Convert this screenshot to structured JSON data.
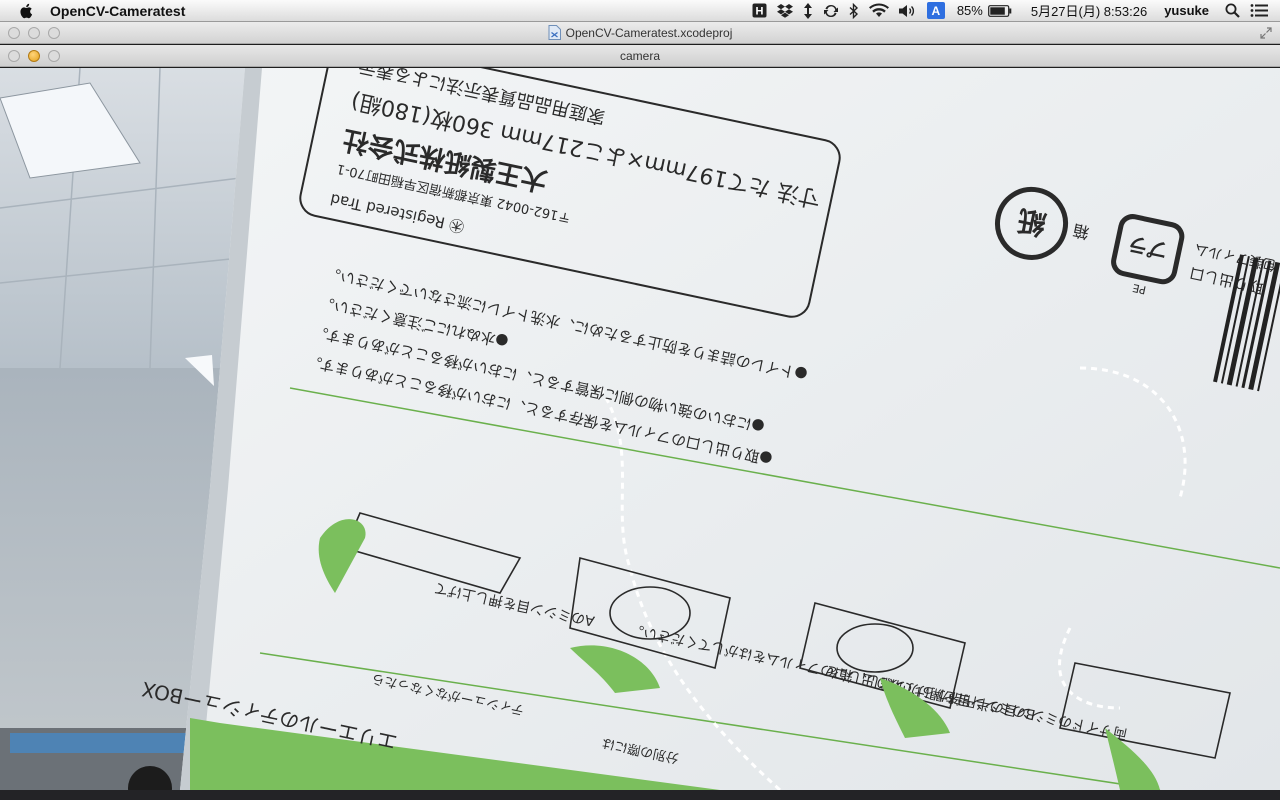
{
  "menubar": {
    "app_name": "OpenCV-Cameratest",
    "battery": "85%",
    "input_source": "A",
    "datetime": "5月27日(月)  8:53:26",
    "user": "yusuke",
    "icons": [
      "apple-icon",
      "h-icon",
      "dropbox-icon",
      "updown-icon",
      "sync-icon",
      "bluetooth-icon",
      "wifi-icon",
      "volume-icon",
      "input-source-icon",
      "battery-icon",
      "spotlight-icon",
      "list-icon"
    ]
  },
  "windows": {
    "project_title": "OpenCV-Cameratest.xcodeproj",
    "camera_title": "camera"
  },
  "camera_scene": {
    "box_top": [
      "㊍ Registered Trad",
      "〒162-0042 東京都新宿区早稲田町70-1",
      "大王製紙株式会社",
      "寸法 たて197mm×よこ217mm 360枚(180組)",
      "家庭用品品質表示法による表示"
    ],
    "box_recycle": [
      "紙",
      "箱",
      "プラ",
      "取り出し口",
      "：包装フィルム",
      "PE"
    ],
    "box_notes": [
      "●取り出し口のフィルムを保存すると、においが移ることがあります。",
      "●においの強い物の側に保管すると、においが移ることがあります。",
      "●水ぬれにご注意ください。",
      "●トイレの詰まりを防止するために、水洗トイレに流さないでください。"
    ],
    "box_steps": [
      "Aのミシン目を押し上げて",
      "Bのミシン目を開けて取り出し口のフィルムをはがしてください。",
      "両サイドのミシン目の半円部から切り離し、箱を"
    ],
    "box_bottom": [
      "エリエールのティシューBOX",
      "ティシューがなくなったら",
      "分別の際には"
    ]
  },
  "colors": {
    "accent_green": "#6ab04c",
    "input_badge": "#2f6fe0"
  }
}
